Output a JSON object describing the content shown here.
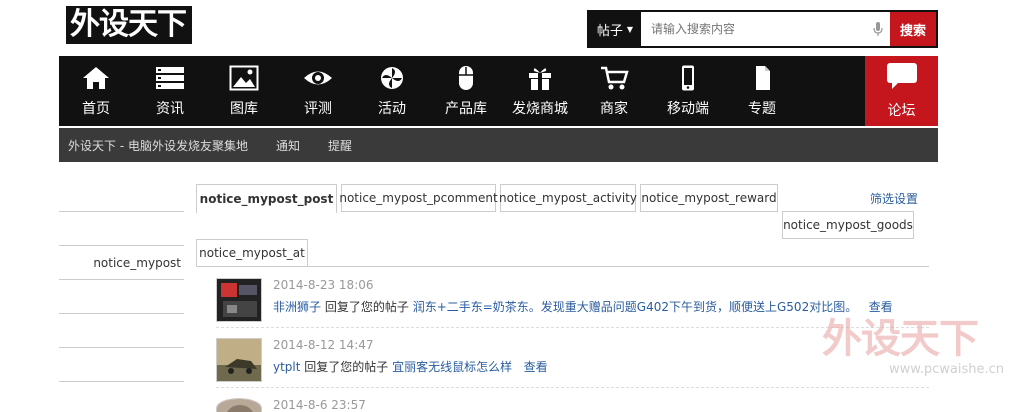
{
  "header": {
    "logo_text": "外设天下",
    "search": {
      "type_label": "帖子",
      "placeholder": "请输入搜索内容",
      "button_label": "搜索"
    }
  },
  "nav": {
    "items": [
      {
        "label": "首页",
        "icon": "home-icon"
      },
      {
        "label": "资讯",
        "icon": "list-icon"
      },
      {
        "label": "图库",
        "icon": "image-icon"
      },
      {
        "label": "评测",
        "icon": "eye-icon"
      },
      {
        "label": "活动",
        "icon": "pinwheel-icon"
      },
      {
        "label": "产品库",
        "icon": "mouse-icon"
      },
      {
        "label": "发烧商城",
        "icon": "gift-icon"
      },
      {
        "label": "商家",
        "icon": "cart-icon"
      },
      {
        "label": "移动端",
        "icon": "phone-icon"
      },
      {
        "label": "专题",
        "icon": "document-icon"
      }
    ],
    "forum_label": "论坛",
    "forum_icon": "chat-bubble-icon",
    "accent_color": "#c5161d"
  },
  "subbar": {
    "items": [
      "外设天下 - 电脑外设发烧友聚集地",
      "通知",
      "提醒"
    ]
  },
  "sidebar": {
    "label": "notice_mypost"
  },
  "tabs": [
    "notice_mypost_post",
    "notice_mypost_pcomment",
    "notice_mypost_activity",
    "notice_mypost_reward",
    "notice_mypost_goods",
    "notice_mypost_at"
  ],
  "filter_label": "筛选设置",
  "notices": [
    {
      "time": "2014-8-23 18:06",
      "user": "非洲狮子",
      "action": "回复了您的帖子",
      "title": "润东+二手东=奶茶东。发现重大赠品问题G402下午到货，顺便送上G502对比图。",
      "view": "查看"
    },
    {
      "time": "2014-8-12 14:47",
      "user": "ytplt",
      "action": "回复了您的帖子",
      "title": "宜丽客无线鼠标怎么样",
      "view": "查看"
    },
    {
      "time": "2014-8-6 23:57",
      "user": "",
      "action": "",
      "title": "",
      "view": ""
    }
  ],
  "watermark": {
    "logo": "外设天下",
    "url": "www.pcwaishe.cn"
  }
}
